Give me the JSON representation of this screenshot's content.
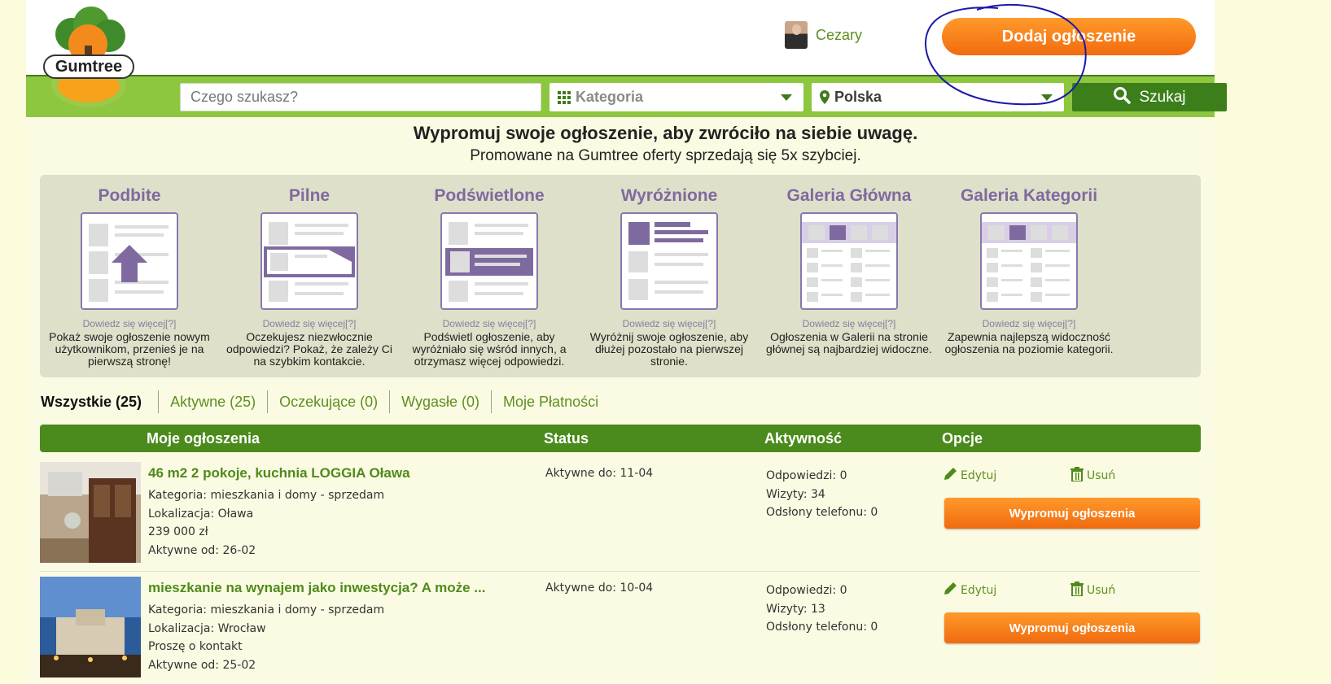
{
  "header": {
    "logo_text": "Gumtree",
    "user_name": "Cezary",
    "add_button": "Dodaj ogłoszenie"
  },
  "search": {
    "placeholder": "Czego szukasz?",
    "category": "Kategoria",
    "location": "Polska",
    "button": "Szukaj"
  },
  "promo": {
    "title": "Wypromuj swoje ogłoszenie, aby zwróciło na siebie uwagę.",
    "subtitle": "Promowane na Gumtree oferty sprzedają się 5x szybciej.",
    "learn_more": "Dowiedz się więcej[?]",
    "cards": [
      {
        "title": "Podbite",
        "desc": "Pokaż swoje ogłoszenie nowym użytkownikom, przenieś je na pierwszą stronę!"
      },
      {
        "title": "Pilne",
        "desc": "Oczekujesz niezwłocznie odpowiedzi? Pokaż, że zależy Ci na szybkim kontakcie."
      },
      {
        "title": "Podświetlone",
        "desc": "Podświetl ogłoszenie, aby wyróżniało się wśród innych, a otrzymasz więcej odpowiedzi."
      },
      {
        "title": "Wyróżnione",
        "desc": "Wyróżnij swoje ogłoszenie, aby dłużej pozostało na pierwszej stronie."
      },
      {
        "title": "Galeria Główna",
        "desc": "Ogłoszenia w Galerii na stronie głównej są najbardziej widoczne."
      },
      {
        "title": "Galeria Kategorii",
        "desc": "Zapewnia najlepszą widoczność ogłoszenia na poziomie kategorii."
      }
    ]
  },
  "tabs": [
    "Wszystkie (25)",
    "Aktywne (25)",
    "Oczekujące (0)",
    "Wygasłe (0)",
    "Moje Płatności"
  ],
  "table": {
    "headers": [
      "Moje ogłoszenia",
      "Status",
      "Aktywność",
      "Opcje"
    ],
    "edit_label": "Edytuj",
    "delete_label": "Usuń",
    "promote_label": "Wypromuj ogłoszenia",
    "rows": [
      {
        "title": "46 m2 2 pokoje, kuchnia LOGGIA Oława",
        "category": "Kategoria: mieszkania i domy - sprzedam",
        "location": "Lokalizacja: Oława",
        "price": "239 000 zł",
        "active_from": "Aktywne od: 26-02",
        "status": "Aktywne do: 11-04",
        "replies": "Odpowiedzi: 0",
        "visits": "Wizyty: 34",
        "phone": "Odsłony telefonu: 0"
      },
      {
        "title": "mieszkanie na wynajem jako inwestycja? A może ...",
        "category": "Kategoria: mieszkania i domy - sprzedam",
        "location": "Lokalizacja: Wrocław",
        "price": "Proszę o kontakt",
        "active_from": "Aktywne od: 25-02",
        "status": "Aktywne do: 10-04",
        "replies": "Odpowiedzi: 0",
        "visits": "Wizyty: 13",
        "phone": "Odsłony telefonu: 0"
      }
    ]
  }
}
